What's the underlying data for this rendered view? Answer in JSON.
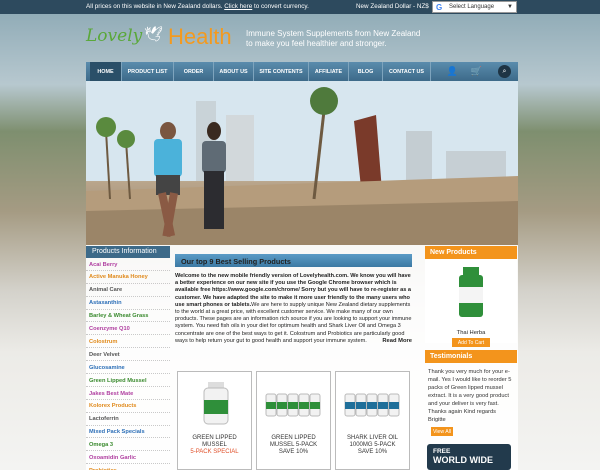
{
  "topbar": {
    "message": "All prices on this website in New Zealand dollars.",
    "link": "Click here",
    "message_end": "to convert currency.",
    "currency": "New Zealand Dollar - NZ$",
    "language": "Select Language"
  },
  "brand": {
    "word1": "Lovely",
    "word2": "Health",
    "tagline1": "Immune System Supplements from New Zealand",
    "tagline2": "to make you feel healthier and stronger."
  },
  "nav": [
    "HOME",
    "PRODUCT LIST",
    "ORDER",
    "ABOUT US",
    "SITE CONTENTS",
    "AFFILIATE",
    "BLOG",
    "CONTACT US"
  ],
  "sidebar": {
    "title": "Products Information",
    "items": [
      {
        "label": "Acai Berry",
        "color": "#b03fa0"
      },
      {
        "label": "Active Manuka Honey",
        "color": "#e08a1c"
      },
      {
        "label": "Animal Care",
        "color": "#555555"
      },
      {
        "label": "Astaxanthin",
        "color": "#2d6fb7"
      },
      {
        "label": "Barley & Wheat Grass",
        "color": "#3a8a2e"
      },
      {
        "label": "Coenzyme Q10",
        "color": "#b03fa0"
      },
      {
        "label": "Colostrum",
        "color": "#e08a1c"
      },
      {
        "label": "Deer Velvet",
        "color": "#555555"
      },
      {
        "label": "Glucosamine",
        "color": "#2d6fb7"
      },
      {
        "label": "Green Lipped Mussel",
        "color": "#3a8a2e"
      },
      {
        "label": "Jakes Best Mate",
        "color": "#b03fa0"
      },
      {
        "label": "Kolorex Products",
        "color": "#e08a1c"
      },
      {
        "label": "Lactoferrin",
        "color": "#555555"
      },
      {
        "label": "Mixed Pack Specials",
        "color": "#2d6fb7"
      },
      {
        "label": "Omega 3",
        "color": "#3a8a2e"
      },
      {
        "label": "Oxoamidin Garlic",
        "color": "#b03fa0"
      },
      {
        "label": "Probiotics",
        "color": "#e08a1c"
      }
    ]
  },
  "main": {
    "title": "Our top 9 Best Selling Products",
    "intro_bold": "Welcome to the new mobile friendly version of Lovelyhealth.com. We know you will have a better experience on our new site if you use the Google Chrome browser which is available free  https://www.google.com/chrome/  Sorry but you will have to re-register as a customer.  We have adapted the site to make it more user friendly to the many users who use smart phones or tablets.",
    "intro_rest": "We are here to supply unique New Zealand dietary supplements to the world at a great price, with excellent customer service. We make many of our own products. These pages are an information rich source if you are looking to support your immune system. You need fish oils in your diet for optimum health and Shark Liver Oil and Omega 3 concentrate are one of the best ways to get it. Colostrum and Probiotics are particularly good ways to help return your gut to good health and support your immune system.",
    "read_more": "Read More",
    "products": [
      {
        "line1": "GREEN LIPPED",
        "line2": "MUSSEL",
        "line3": "5-PACK SPECIAL"
      },
      {
        "line1": "GREEN LIPPED",
        "line2": "MUSSEL 5-PACK",
        "line3": "SAVE 10%"
      },
      {
        "line1": "SHARK LIVER OIL",
        "line2": "1000MG 5-PACK",
        "line3": "SAVE 10%"
      }
    ]
  },
  "right": {
    "new_title": "New Products",
    "new_name": "Thai Herba",
    "add_cart": "Add To Cart",
    "testi_title": "Testimonials",
    "testi_text": "Thank you very much for your e-mail. Yes I would like to reorder 5 packs of Green lipped mussel extract. It is a very good product and your deliver is very fast. Thanks again Kind regards Brigitte",
    "view_all": "View All",
    "fww1": "FREE",
    "fww2": "WORLD WIDE"
  },
  "colors": {
    "accent": "#f3941c",
    "nav": "#3d6a89",
    "topbar": "#2d4a5e"
  }
}
